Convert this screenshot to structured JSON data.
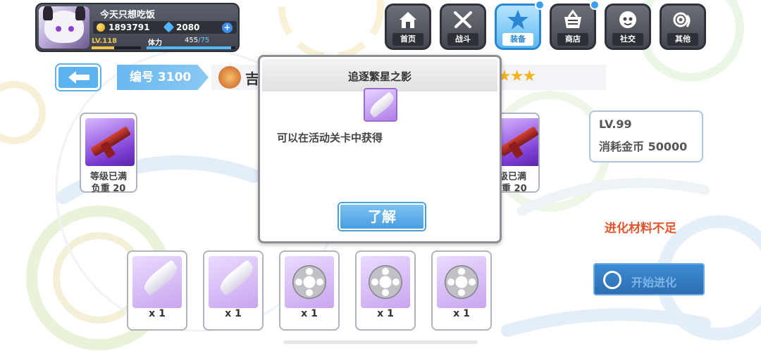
{
  "player": {
    "name": "今天只想吃饭",
    "gold": "1893791",
    "gems": "2080",
    "level": "LV.118",
    "level_progress": 0.45,
    "stamina_label": "体力",
    "stamina_current": "455",
    "stamina_max": "/75",
    "stamina_progress": 0.95
  },
  "nav": {
    "home": "首页",
    "battle": "战斗",
    "equipment": "装备",
    "shop": "商店",
    "social": "社交",
    "other": "其他"
  },
  "header": {
    "number": "编号 3100",
    "title_fragment": "吉",
    "star_count": 3
  },
  "weapons": {
    "left": {
      "status": "等级已满",
      "weight": "负重 20"
    },
    "right": {
      "status": "级已满",
      "weight": "重 20"
    }
  },
  "info": {
    "level": "LV.99",
    "cost": "消耗金币 50000"
  },
  "warning": "进化材料不足",
  "evolve_button": "开始进化",
  "materials": [
    {
      "icon": "feather-icon",
      "qty": "x 1"
    },
    {
      "icon": "feather-icon",
      "qty": "x 1"
    },
    {
      "icon": "film-reel-icon",
      "qty": "x 1"
    },
    {
      "icon": "film-reel-icon",
      "qty": "x 1"
    },
    {
      "icon": "film-reel-icon",
      "qty": "x 1"
    }
  ],
  "dialog": {
    "title": "追逐繁星之影",
    "description": "可以在活动关卡中获得",
    "ok_button": "了解"
  },
  "colors": {
    "accent_blue": "#4a9fe0",
    "warning_red": "#e2542a",
    "star_gold": "#f5b21f",
    "nav_active": "#5cb9f2"
  }
}
